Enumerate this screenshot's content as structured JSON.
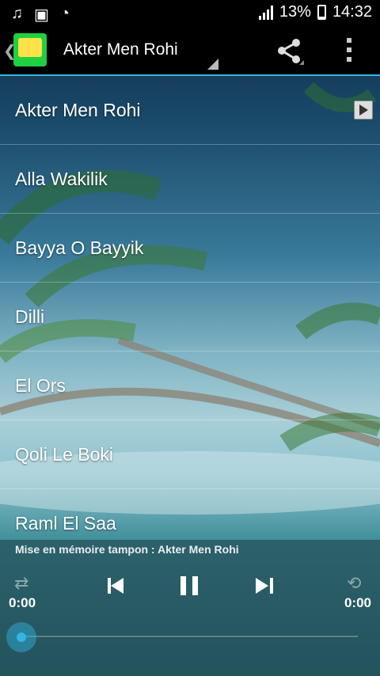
{
  "status_bar": {
    "icons": [
      "music-note-icon",
      "image-icon",
      "chat-icon"
    ],
    "battery_percent": "13%",
    "time": "14:32"
  },
  "app_bar": {
    "title": "Akter Men Rohi",
    "icons": [
      "app-logo",
      "share-icon",
      "overflow-menu-icon"
    ]
  },
  "list": {
    "items": [
      {
        "label": "Akter Men Rohi",
        "playing": true
      },
      {
        "label": "Alla Wakilik"
      },
      {
        "label": "Bayya O Bayyik"
      },
      {
        "label": "Dilli"
      },
      {
        "label": "El Ors"
      },
      {
        "label": "Qoli Le Boki"
      },
      {
        "label": "Raml El Saa"
      }
    ]
  },
  "player": {
    "buffer_text": "Mise en mémoire tampon : Akter Men Rohi",
    "elapsed": "0:00",
    "duration": "0:00",
    "progress": 0,
    "controls": [
      "shuffle-icon",
      "previous-icon",
      "pause-icon",
      "next-icon",
      "repeat-icon"
    ]
  },
  "colors": {
    "accent": "#33b5e5",
    "bar_background": "#000000"
  }
}
